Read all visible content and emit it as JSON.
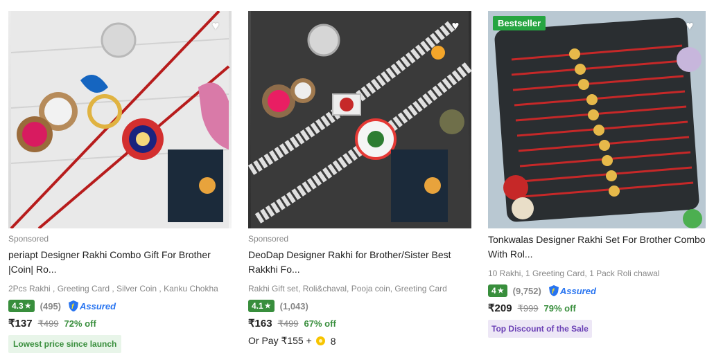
{
  "products": [
    {
      "sponsored": "Sponsored",
      "title": "periapt Designer Rakhi Combo Gift For Brother |Coin| Ro...",
      "subtitle": "2Pcs Rakhi , Greeting Card , Silver Coin , Kanku Chokha",
      "rating": "4.3",
      "rating_count": "(495)",
      "assured": "Assured",
      "price": "₹137",
      "mrp": "₹499",
      "discount": "72% off",
      "tag": "Lowest price since launch"
    },
    {
      "sponsored": "Sponsored",
      "title": "DeoDap Designer Rakhi for Brother/Sister Best Rakkhi Fo...",
      "subtitle": "Rakhi Gift set, Roli&chaval, Pooja coin, Greeting Card",
      "rating": "4.1",
      "rating_count": "(1,043)",
      "price": "₹163",
      "mrp": "₹499",
      "discount": "67% off",
      "or_pay_prefix": "Or Pay ₹155 +",
      "or_pay_coins": "8"
    },
    {
      "badge": "Bestseller",
      "title": "Tonkwalas Designer Rakhi Set For Brother Combo With Rol...",
      "subtitle": "10 Rakhi, 1 Greeting Card, 1 Pack Roli chawal",
      "rating": "4",
      "rating_count": "(9,752)",
      "assured": "Assured",
      "price": "₹209",
      "mrp": "₹999",
      "discount": "79% off",
      "tag": "Top Discount of the Sale"
    }
  ],
  "icons": {
    "wishlist": "heart-icon",
    "star": "star-icon",
    "assured": "shield-icon",
    "coin": "supercoin-icon"
  },
  "colors": {
    "rating_bg": "#388e3c",
    "assured": "#2874f0",
    "discount": "#388e3c",
    "bestseller": "#26a541"
  }
}
